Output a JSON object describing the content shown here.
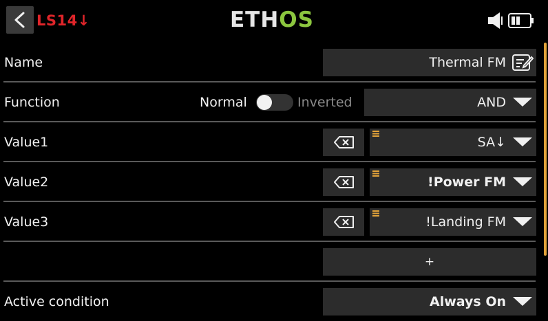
{
  "header": {
    "screen_tag": "LS14↓",
    "logo_part1": "ETH",
    "logo_part2": "OS"
  },
  "rows": {
    "name": {
      "label": "Name",
      "value": "Thermal FM"
    },
    "function": {
      "label": "Function",
      "toggle_off_label": "Normal",
      "toggle_on_label": "Inverted",
      "value": "AND"
    },
    "value1": {
      "label": "Value1",
      "value": "SA↓"
    },
    "value2": {
      "label": "Value2",
      "value": "!Power FM"
    },
    "value3": {
      "label": "Value3",
      "value": "!Landing FM"
    },
    "add": {
      "label": "+"
    },
    "active_condition": {
      "label": "Active condition",
      "value": "Always On"
    }
  },
  "colors": {
    "background": "#000000",
    "field": "#2c2c2c",
    "tag_red": "#e0252a",
    "logo_green": "#8cc63f",
    "accent_orange": "#e3a33a",
    "divider": "#5a5a5a"
  }
}
